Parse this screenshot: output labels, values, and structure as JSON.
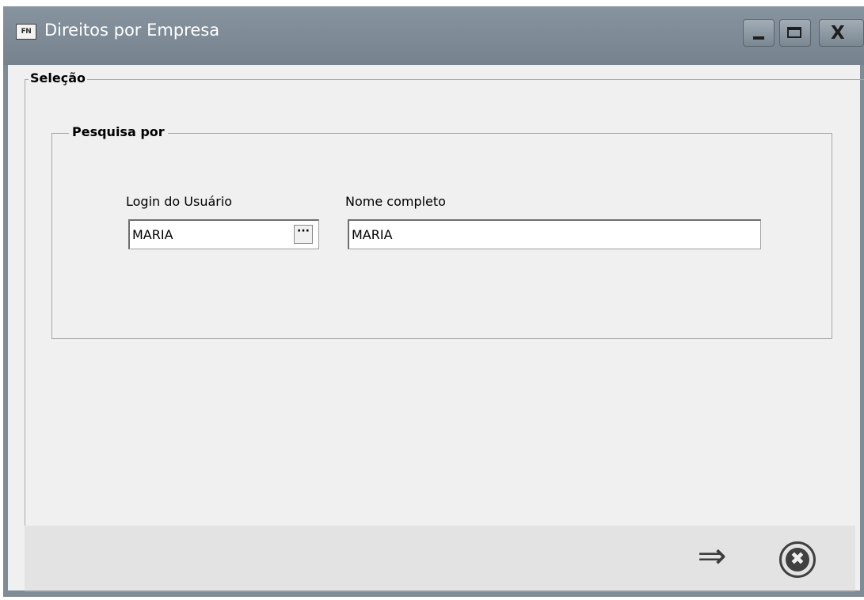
{
  "window": {
    "app_icon_text": "FN",
    "title": "Direitos por Empresa",
    "close_glyph": "X"
  },
  "selecao": {
    "legend": "Seleção"
  },
  "pesquisa": {
    "legend": "Pesquisa por",
    "login_label": "Login do Usuário",
    "login_value": "MARIA",
    "lookup_button": "···",
    "nome_label": "Nome completo",
    "nome_value": "MARIA"
  },
  "footer": {
    "next_glyph": "⇒",
    "cancel_glyph": "✖"
  },
  "icons": {
    "app": "fn-app-icon",
    "minimize": "minimize-icon",
    "maximize": "maximize-icon",
    "close": "close-icon",
    "next": "arrow-right-icon",
    "cancel": "cancel-circle-icon"
  }
}
